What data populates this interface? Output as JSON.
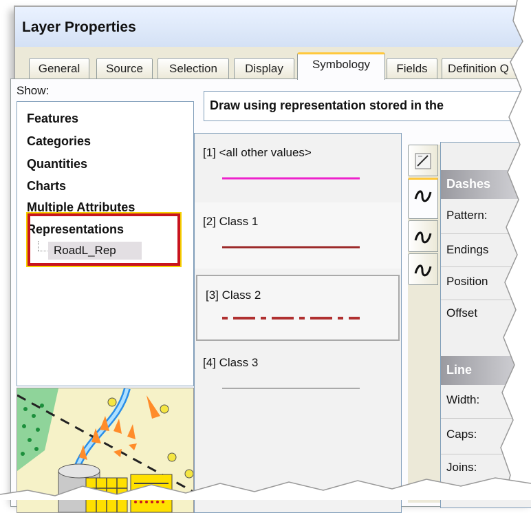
{
  "window": {
    "title": "Layer Properties"
  },
  "tabs": [
    {
      "label": "General"
    },
    {
      "label": "Source"
    },
    {
      "label": "Selection"
    },
    {
      "label": "Display"
    },
    {
      "label": "Symbology"
    },
    {
      "label": "Fields"
    },
    {
      "label": "Definition Q"
    }
  ],
  "active_tab": "Symbology",
  "show": {
    "label": "Show:",
    "items": [
      {
        "label": "Features"
      },
      {
        "label": "Categories"
      },
      {
        "label": "Quantities"
      },
      {
        "label": "Charts"
      },
      {
        "label": "Multiple Attributes"
      },
      {
        "label": "Representations"
      }
    ],
    "sub_item": "RoadL_Rep"
  },
  "draw_label": "Draw using representation stored in the",
  "classes": [
    {
      "label": "[1] <all other values>",
      "line_color": "#ee22cc",
      "style": "solid"
    },
    {
      "label": "[2] Class 1",
      "line_color": "#9c2a2a",
      "style": "solid"
    },
    {
      "label": "[3] Class 2",
      "line_color": "#b03030",
      "style": "dashed"
    },
    {
      "label": "[4] Class 3",
      "line_color": "#aaaaaa",
      "style": "solid"
    }
  ],
  "sections": {
    "dashes": {
      "title": "Dashes",
      "rows": [
        {
          "label": "Pattern:"
        },
        {
          "label": "Endings"
        },
        {
          "label": "Position"
        },
        {
          "label": "Offset"
        }
      ]
    },
    "line": {
      "title": "Line",
      "rows": [
        {
          "label": "Width:"
        },
        {
          "label": "Caps:"
        },
        {
          "label": "Joins:"
        }
      ]
    }
  },
  "colors": {
    "highlight_border": "#c8141e",
    "highlight_outline": "#f5d200",
    "tab_active_accent": "#ffc83c"
  }
}
